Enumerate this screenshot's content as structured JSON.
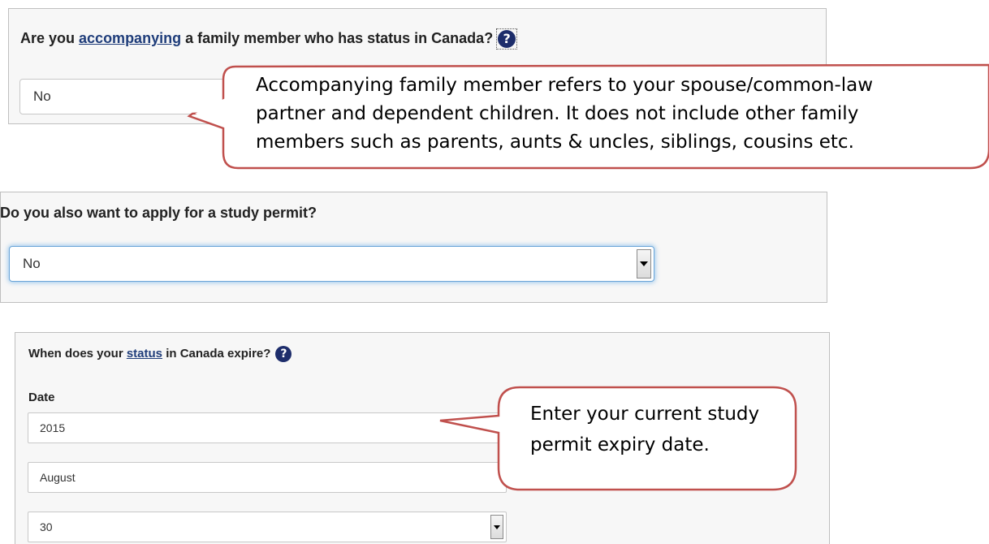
{
  "q1": {
    "label_before": "Are you ",
    "link": "accompanying",
    "label_after": " a family member who has status in Canada?",
    "help_icon": "question-circle-icon",
    "value": "No"
  },
  "callout1": {
    "lines": [
      "Accompanying family member refers to your spouse/common-law",
      "partner and dependent children. It does not include other family",
      "members such as parents, aunts & uncles, siblings, cousins etc."
    ]
  },
  "q2": {
    "label": "Do you also want to apply for a study permit?",
    "value": "No"
  },
  "q3": {
    "label_before": "When does your ",
    "link": "status",
    "label_after": " in Canada expire?",
    "help_icon": "question-circle-icon",
    "date_label": "Date",
    "year": "2015",
    "month": "August",
    "day": "30"
  },
  "callout2": {
    "lines": [
      "Enter your current study",
      "permit expiry date."
    ]
  },
  "colors": {
    "callout_border": "#c0504d",
    "help_icon": "#1d2d6b",
    "link": "#1f3d7a",
    "focus_glow": "#6aa5d8"
  }
}
